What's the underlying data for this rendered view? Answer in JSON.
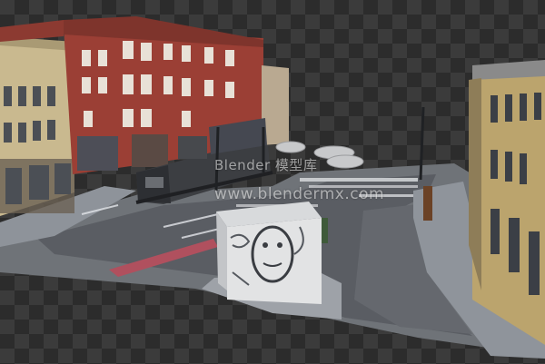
{
  "watermark": {
    "top": "Blender 模型库",
    "main": "www.blendermx.com"
  },
  "colors": {
    "background_dark": "#2c2c2c",
    "background_light": "#3b3b3b",
    "brick": "#9b3f35",
    "asphalt": "#5a5d63",
    "sidewalk": "#8e939a",
    "bike_lane": "#b0505e"
  }
}
